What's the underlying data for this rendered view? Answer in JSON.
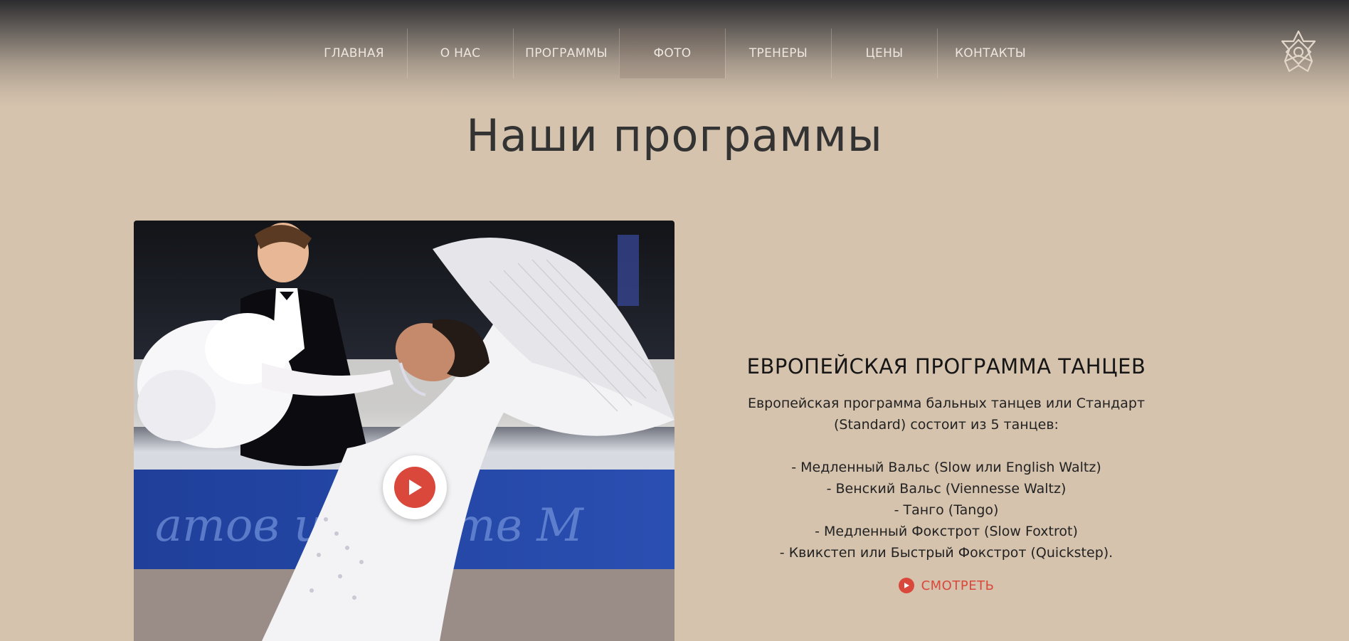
{
  "nav": {
    "items": [
      {
        "label": "ГЛАВНАЯ"
      },
      {
        "label": "О НАС"
      },
      {
        "label": "ПРОГРАММЫ"
      },
      {
        "label": "ФОТО"
      },
      {
        "label": "ТРЕНЕРЫ"
      },
      {
        "label": "ЦЕНЫ"
      },
      {
        "label": "КОНТАКТЫ"
      }
    ],
    "active": "ФОТО",
    "logo_icon": "star-ornament-icon"
  },
  "page": {
    "title": "Наши программы"
  },
  "program": {
    "title": "ЕВРОПЕЙСКАЯ ПРОГРАММА ТАНЦЕВ",
    "intro_line1": "Европейская программа бальных танцев или Стандарт",
    "intro_line2": "(Standard) состоит из 5 танцев:",
    "dances": [
      "- Медленный Вальс (Slow или English Waltz)",
      "- Венский Вальс (Viennesse Waltz)",
      "- Танго (Tango)",
      "- Медленный Фокстрот (Slow Foxtrot)",
      "- Квикстеп или Быстрый Фокстрот (Quickstep)."
    ],
    "watch_label": "СМОТРЕТЬ",
    "watch_icon": "play-circle-icon",
    "video_icon": "play-icon"
  },
  "colors": {
    "background": "#d5c3ae",
    "accent": "#d9483b",
    "header_dark": "#2c2c2e"
  }
}
